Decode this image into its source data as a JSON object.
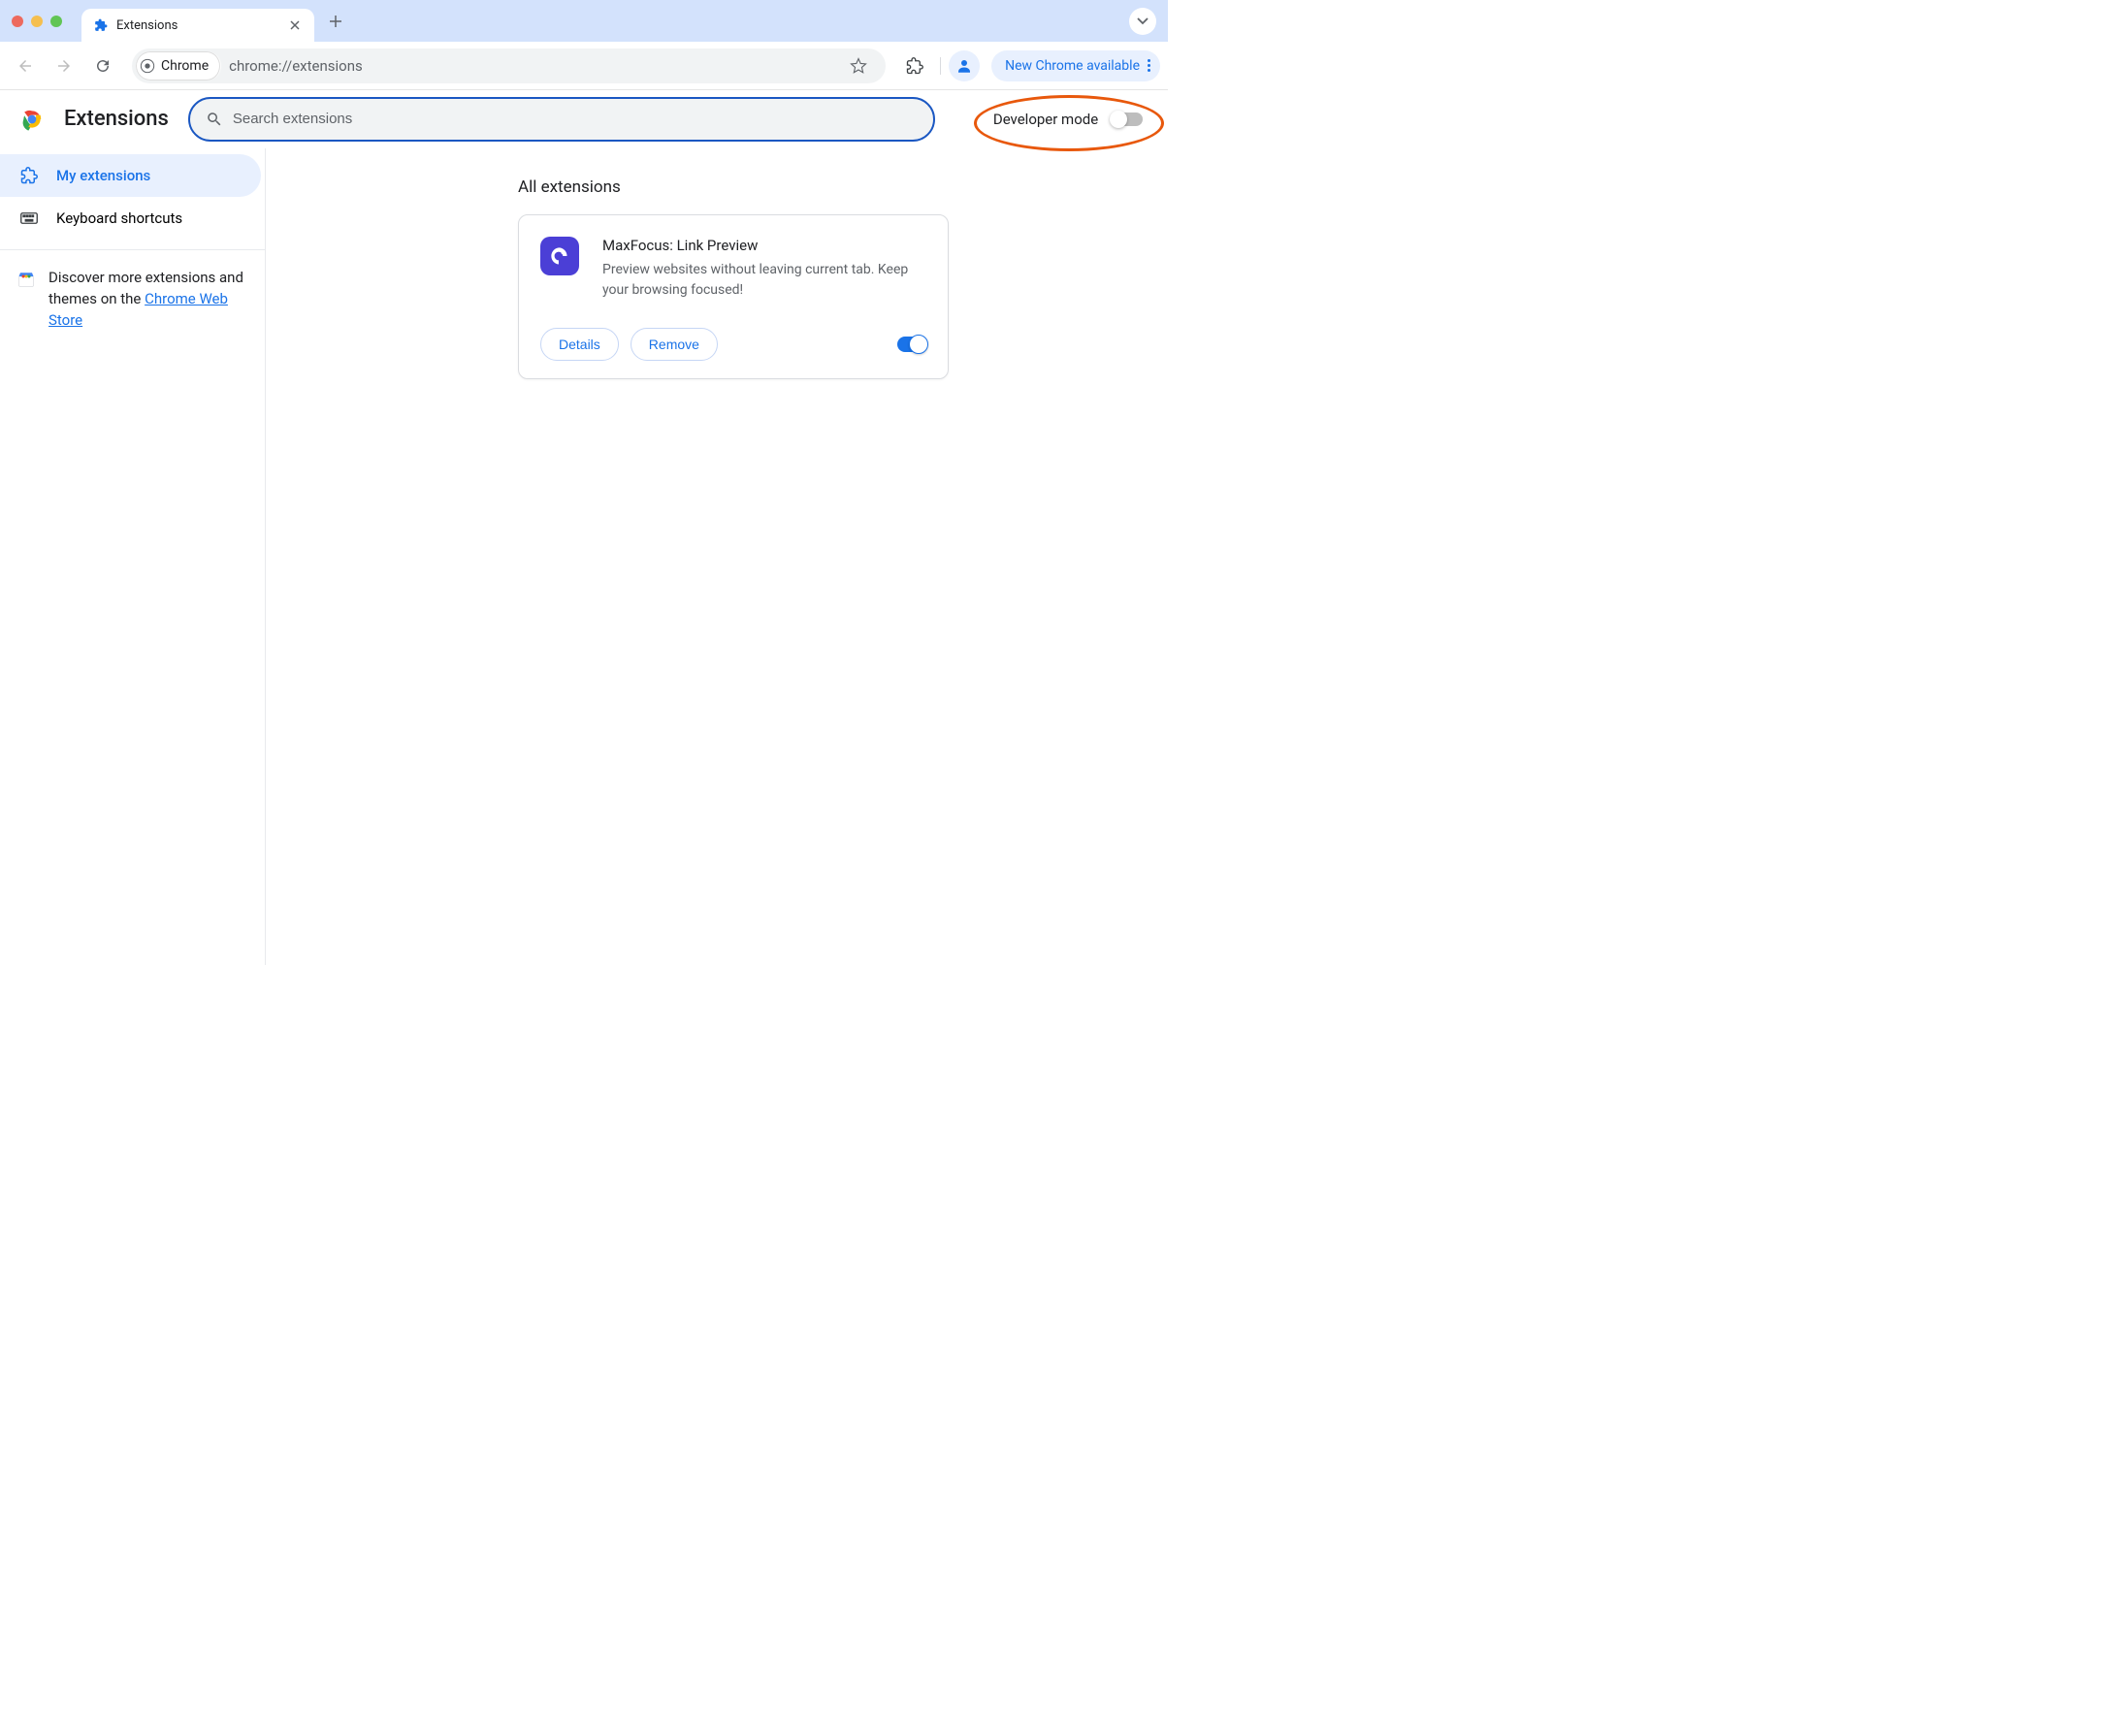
{
  "titlebar": {
    "tab_title": "Extensions",
    "tab_icon_name": "puzzle-icon"
  },
  "toolbar": {
    "omnibox_chip": "Chrome",
    "url": "chrome://extensions",
    "update_label": "New Chrome available"
  },
  "page": {
    "title": "Extensions",
    "search_placeholder": "Search extensions",
    "dev_mode_label": "Developer mode",
    "dev_mode_on": false
  },
  "sidebar": {
    "items": [
      {
        "label": "My extensions",
        "icon": "puzzle",
        "active": true
      },
      {
        "label": "Keyboard shortcuts",
        "icon": "keyboard",
        "active": false
      }
    ],
    "discover_prefix": "Discover more extensions and themes on the ",
    "discover_link": "Chrome Web Store"
  },
  "main": {
    "section_title": "All extensions",
    "extensions": [
      {
        "name": "MaxFocus: Link Preview",
        "description": "Preview websites without leaving current tab. Keep your browsing focused!",
        "details_label": "Details",
        "remove_label": "Remove",
        "enabled": true
      }
    ]
  }
}
